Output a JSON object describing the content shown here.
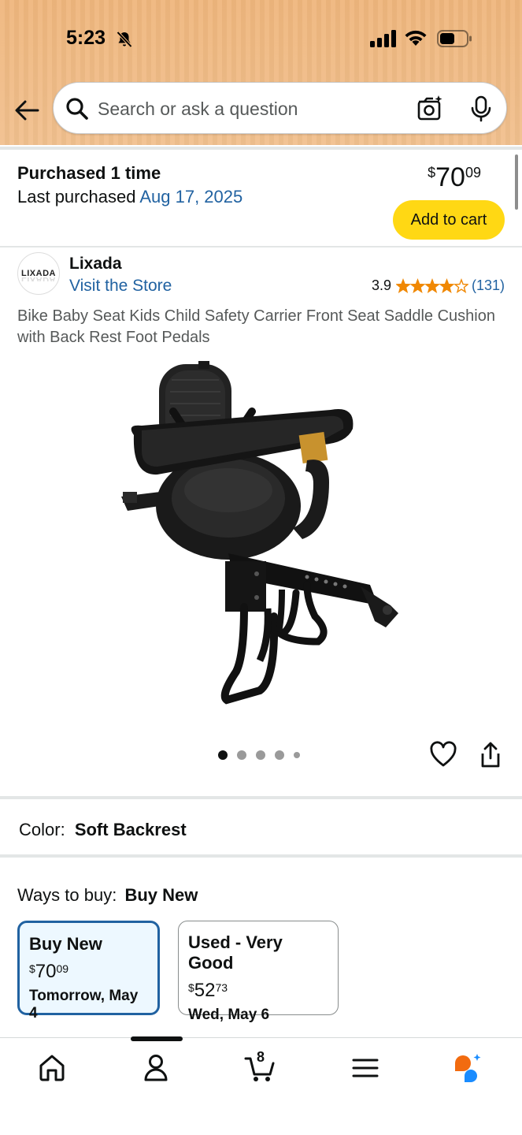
{
  "status_bar": {
    "time": "5:23"
  },
  "search": {
    "placeholder": "Search or ask a question"
  },
  "purchase": {
    "label": "Purchased 1 time",
    "last_prefix": "Last purchased",
    "last_date": "Aug 17, 2025",
    "price_whole": "70",
    "price_frac": "09",
    "currency": "$",
    "add_to_cart": "Add to cart"
  },
  "store": {
    "logo_text": "LIXADA",
    "name": "Lixada",
    "visit_link": "Visit the Store",
    "rating": "3.9",
    "rating_count": "(131)",
    "rating_fraction": 0.78
  },
  "product": {
    "title": "Bike Baby Seat Kids Child Safety Carrier Front Seat Saddle Cushion with Back Rest Foot Pedals",
    "image_count": 5,
    "active_image": 1
  },
  "color": {
    "label": "Color:",
    "value": "Soft Backrest"
  },
  "ways_to_buy": {
    "label": "Ways to buy:",
    "value": "Buy New",
    "options": [
      {
        "title": "Buy New",
        "currency": "$",
        "price_whole": "70",
        "price_frac": "09",
        "delivery": "Tomorrow, May 4"
      },
      {
        "title": "Used - Very Good",
        "currency": "$",
        "price_whole": "52",
        "price_frac": "73",
        "delivery": "Wed, May 6"
      }
    ]
  },
  "nav": {
    "cart_count": "8"
  },
  "colors": {
    "accent": "#2162a1",
    "button": "#ffd814",
    "header": "#efb67d",
    "star": "#f08804"
  }
}
